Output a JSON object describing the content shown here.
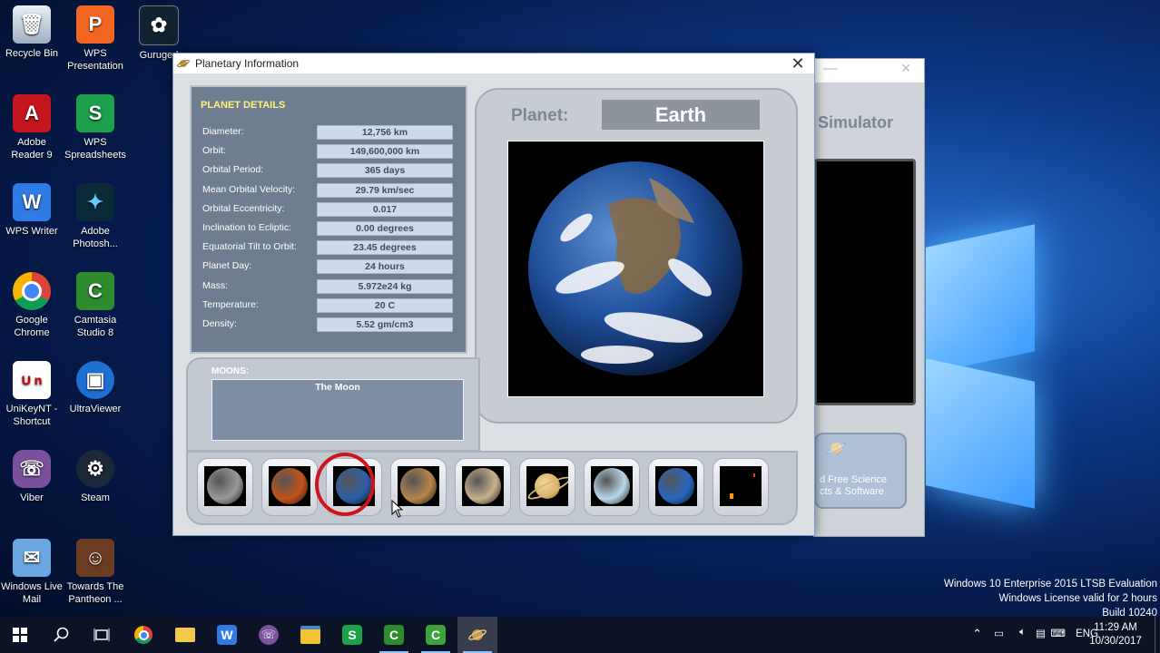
{
  "desktop": {
    "icons": [
      {
        "name": "recycle-bin-icon",
        "label": "Recycle Bin"
      },
      {
        "name": "wps-presentation-icon",
        "label": "WPS Presentation"
      },
      {
        "name": "guruged-icon",
        "label": "Guruged"
      },
      {
        "name": "adobe-reader-icon",
        "label": "Adobe Reader 9"
      },
      {
        "name": "wps-spreadsheets-icon",
        "label": "WPS Spreadsheets"
      },
      {
        "name": "wps-writer-icon",
        "label": "WPS Writer"
      },
      {
        "name": "adobe-photoshop-icon",
        "label": "Adobe Photosh..."
      },
      {
        "name": "google-chrome-icon",
        "label": "Google Chrome"
      },
      {
        "name": "camtasia-icon",
        "label": "Camtasia Studio 8"
      },
      {
        "name": "unikeynt-icon",
        "label": "UniKeyNT - Shortcut"
      },
      {
        "name": "ultraviewer-icon",
        "label": "UltraViewer"
      },
      {
        "name": "viber-icon",
        "label": "Viber"
      },
      {
        "name": "steam-icon",
        "label": "Steam"
      },
      {
        "name": "windows-live-mail-icon",
        "label": "Windows Live Mail"
      },
      {
        "name": "towards-the-pantheon-icon",
        "label": "Towards The Pantheon ..."
      }
    ]
  },
  "bg_window": {
    "title": "Simulator",
    "promo": "d Free Science\ncts & Software"
  },
  "dialog": {
    "title": "Planetary Information",
    "details_heading": "PLANET DETAILS",
    "details": [
      {
        "key": "Diameter:",
        "value": "12,756 km"
      },
      {
        "key": "Orbit:",
        "value": "149,600,000 km"
      },
      {
        "key": "Orbital Period:",
        "value": "365 days"
      },
      {
        "key": "Mean Orbital Velocity:",
        "value": "29.79 km/sec"
      },
      {
        "key": "Orbital  Eccentricity:",
        "value": "0.017"
      },
      {
        "key": "Inclination to Ecliptic:",
        "value": "0.00 degrees"
      },
      {
        "key": "Equatorial Tilt to Orbit:",
        "value": "23.45 degrees"
      },
      {
        "key": "Planet Day:",
        "value": "24 hours"
      },
      {
        "key": "Mass:",
        "value": "5.972e24 kg"
      },
      {
        "key": "Temperature:",
        "value": "20 C"
      },
      {
        "key": "Density:",
        "value": "5.52 gm/cm3"
      }
    ],
    "planet_label": "Planet:",
    "planet_name": "Earth",
    "moons_heading": "MOONS:",
    "moons": [
      "The Moon"
    ],
    "planets": [
      {
        "name": "mercury",
        "color": "#9a9a9a"
      },
      {
        "name": "venus",
        "color": "#c4541a"
      },
      {
        "name": "earth",
        "color": "#2b5fa8"
      },
      {
        "name": "mars",
        "color": "#b8844a"
      },
      {
        "name": "jupiter",
        "color": "#c9b08a"
      },
      {
        "name": "saturn",
        "color": "#d9b36a"
      },
      {
        "name": "uranus",
        "color": "#b9d6ea"
      },
      {
        "name": "neptune",
        "color": "#2767c2"
      },
      {
        "name": "pluto",
        "color": "#000000"
      }
    ],
    "selected_planet": "earth"
  },
  "system": {
    "watermark": [
      "Windows 10 Enterprise 2015 LTSB Evaluation",
      "Windows License valid for 2 hours",
      "Build 10240"
    ],
    "time": "11:29 AM",
    "date": "10/30/2017",
    "language": "ENG"
  },
  "taskbar": [
    "start",
    "search",
    "task-view",
    "chrome",
    "file-explorer-yellow",
    "wps-writer",
    "viber",
    "file-explorer",
    "wps-spreadsheets",
    "camtasia",
    "camtasia-recorder",
    "solar-system-app"
  ]
}
